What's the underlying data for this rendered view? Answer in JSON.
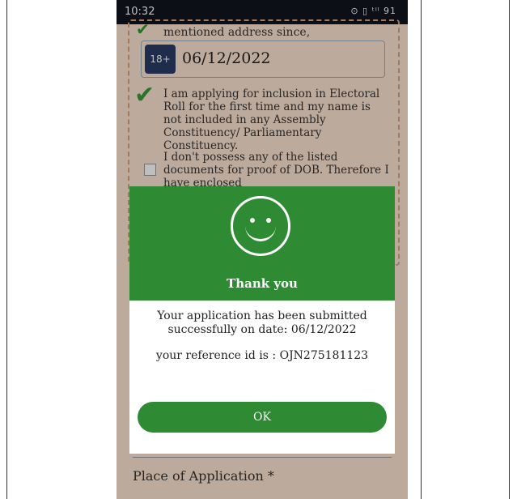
{
  "status_bar": {
    "time": "10:32",
    "indicators": "⊙ ▯ ᵗˡˡ 91"
  },
  "form": {
    "address_text": "mentioned address since,",
    "date_field": {
      "badge": "18+",
      "value": "06/12/2022"
    },
    "declaration_first_time": "I am applying for inclusion in Electoral Roll for the first time and my name is not included in any Assembly Constituency/ Parliamentary Constituency.",
    "declaration_no_dob": "I don't possess any of the listed documents for proof of DOB. Therefore I have enclosed",
    "place_label": "Place of Application *"
  },
  "dialog": {
    "icon": "smiley-icon",
    "title": "Thank you",
    "message": "Your application has been submitted successfully on date: 06/12/2022",
    "reference": "your reference id is : OJN275181123",
    "ok_label": "OK"
  },
  "colors": {
    "accent_green": "#2e8b33",
    "form_bg": "#fbe5d2",
    "status_bar": "#10141d"
  }
}
